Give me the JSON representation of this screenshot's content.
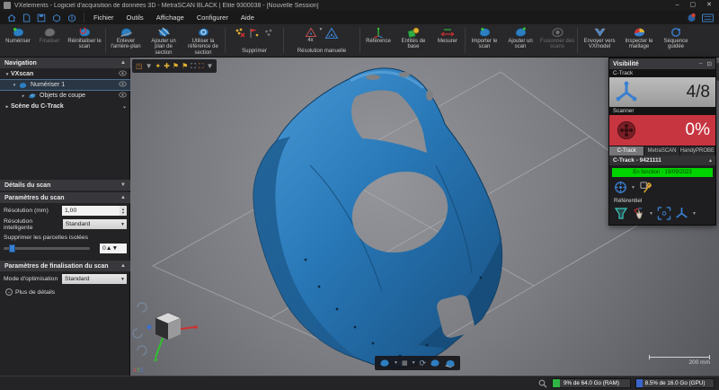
{
  "window": {
    "title": "VXelements - Logiciel d'acquisition de données 3D - MetraSCAN BLACK | Elite 9300038 - [Nouvelle Session]",
    "controls": {
      "minimize": "–",
      "maximize": "▢",
      "close": "✕"
    }
  },
  "menubar": {
    "menus": [
      "Fichier",
      "Outils",
      "Affichage",
      "Configurer",
      "Aide"
    ]
  },
  "toolbar": {
    "buttons": [
      {
        "label": "Numériser"
      },
      {
        "label": "Finaliser"
      },
      {
        "label": "Réinitialiser le scan"
      },
      {
        "label": "Enlever l'arrière-plan"
      },
      {
        "label": "Ajouter un plan de section"
      },
      {
        "label": "Utiliser la référence de section"
      },
      {
        "label": "Référence"
      },
      {
        "label": "Entités de base"
      },
      {
        "label": "Mesurer"
      },
      {
        "label": "Importer le scan"
      },
      {
        "label": "Ajouter un scan"
      },
      {
        "label": "Fusionner des scans"
      },
      {
        "label": "Envoyer vers VXmodel"
      },
      {
        "label": "Inspecter le maillage"
      },
      {
        "label": "Séquence guidée"
      }
    ],
    "groups": {
      "supprimer": "Supprimer",
      "resolution": "Résolution manuelle",
      "resolution_4x": "4x"
    }
  },
  "navigation": {
    "header": "Navigation",
    "items": [
      {
        "label": "VXscan"
      },
      {
        "label": "Numériser 1",
        "selected": true
      },
      {
        "label": "Objets de coupe"
      },
      {
        "label": "Scène du C-Track"
      }
    ]
  },
  "scan_details": {
    "header": "Détails du scan",
    "parametres_scan": {
      "header": "Paramètres du scan",
      "resolution_label": "Résolution (mm)",
      "resolution_value": "1,00",
      "resolution_intelligente_label": "Résolution intelligente",
      "resolution_intelligente_value": "Standard",
      "parcelles_label": "Supprimer les parcelles isolées",
      "parcelles_value": "0"
    },
    "finalisation": {
      "header": "Paramètres de finalisation du scan",
      "mode_label": "Mode d'optimisation",
      "mode_value": "Standard",
      "more_label": "Plus de détails"
    }
  },
  "visibility_panel": {
    "header": "Visibilité",
    "ctrack_label": "C-Track",
    "ctrack_value": "4/8",
    "scanner_label": "Scanner",
    "scanner_value": "0%",
    "tabs": [
      "C-Track",
      "MetraSCAN",
      "HandyPROBE"
    ],
    "active_tab": "C-Track",
    "device_header": "C-Track - 9421111",
    "status_text": "En fonction - 19/09/2023",
    "referential_label": "Référentiel"
  },
  "viewport": {
    "scale_label": "200 mm",
    "axis_label": "XYZ"
  },
  "statusbar": {
    "ram": "9% de 64.0 Go (RAM)",
    "gpu": "8.5% de 16.0 Go (GPU)",
    "ram_pct": 9,
    "gpu_pct": 8.5
  },
  "colors": {
    "accent_blue": "#2e86c8",
    "object_blue": "#2470ad",
    "status_green": "#00d400",
    "status_red": "#c63540",
    "ram_green": "#2fb344",
    "gpu_blue": "#3a66cc"
  }
}
